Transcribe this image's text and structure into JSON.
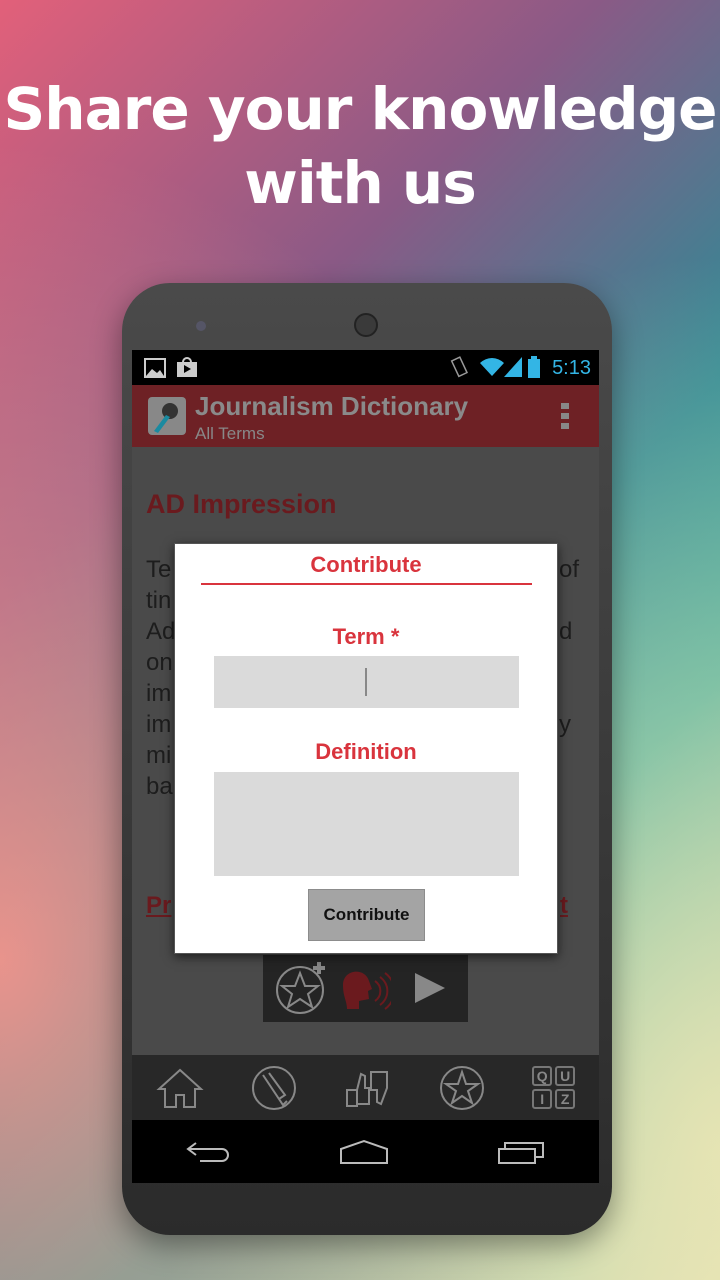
{
  "headline": {
    "line1": "Share your knowledge",
    "line2": "with us"
  },
  "status_bar": {
    "time": "5:13",
    "icons": [
      "image-icon",
      "play-store-icon",
      "vibrate-icon",
      "wifi-icon",
      "signal-icon",
      "battery-icon"
    ]
  },
  "action_bar": {
    "title": "Journalism Dictionary",
    "subtitle": "All Terms",
    "menu_icon": "overflow-menu-icon"
  },
  "content": {
    "term": "AD Impression",
    "definition_left_fragments": [
      "Te",
      "tin",
      "Ad",
      "on",
      "im",
      "im",
      "mi",
      "ba"
    ],
    "definition_right_fragments": [
      "of",
      "",
      "d",
      "",
      "",
      "y",
      "",
      ""
    ],
    "prev_link_fragment": "Pr",
    "next_link_fragment": "t",
    "action_icons": [
      "favorite-add-icon",
      "speak-icon",
      "play-icon"
    ]
  },
  "dialog": {
    "title": "Contribute",
    "term_label": "Term",
    "required_mark": "*",
    "term_value": "",
    "definition_label": "Definition",
    "definition_value": "",
    "submit_label": "Contribute"
  },
  "bottom_nav": [
    "home-icon",
    "pen-icon",
    "thumbs-icon",
    "star-icon",
    "quiz-icon"
  ],
  "quiz_letters": [
    "Q",
    "U",
    "I",
    "Z"
  ],
  "colors": {
    "accent": "#d9343d",
    "action_bar": "#6e2125",
    "status_text": "#33b5e5"
  }
}
